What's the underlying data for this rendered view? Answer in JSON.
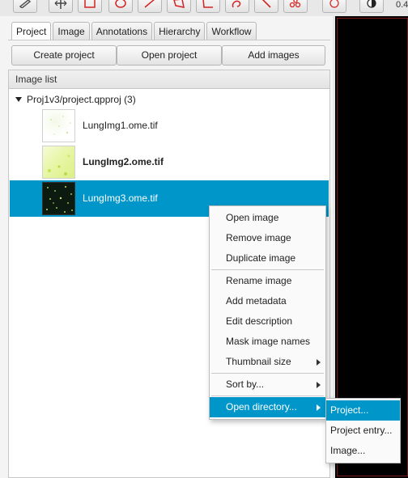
{
  "toolbar": {
    "tools": [
      "ruler-icon",
      "move-icon",
      "rectangle-icon",
      "ellipse-icon",
      "line-icon",
      "polygon-icon",
      "polyline-icon",
      "brush-icon",
      "wand-icon",
      "points-icon",
      "selection-mode-icon",
      "contrast-icon"
    ],
    "number": "0.4"
  },
  "tabs": [
    "Project",
    "Image",
    "Annotations",
    "Hierarchy",
    "Workflow"
  ],
  "buttons": {
    "create": "Create project",
    "open": "Open project",
    "add": "Add images"
  },
  "list": {
    "header": "Image list",
    "root": "Proj1v3/project.qpproj (3)",
    "items": [
      "LungImg1.ome.tif",
      "LungImg2.ome.tif",
      "LungImg3.ome.tif"
    ]
  },
  "context_menu": {
    "items": [
      "Open image",
      "Remove image",
      "Duplicate image",
      "Rename image",
      "Add metadata",
      "Edit description",
      "Mask image names",
      "Thumbnail size",
      "Sort by...",
      "Open directory..."
    ]
  },
  "submenu": {
    "items": [
      "Project...",
      "Project entry...",
      "Image..."
    ]
  },
  "colors": {
    "selection": "#0096c9",
    "tool_red": "#d42222"
  }
}
